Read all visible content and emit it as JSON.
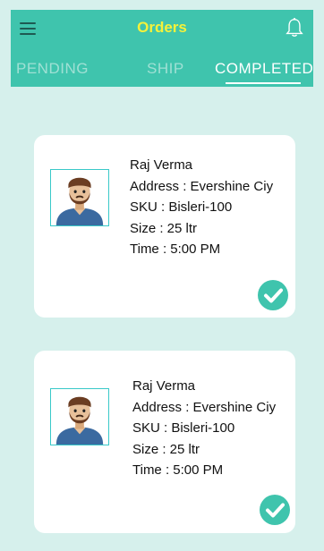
{
  "header": {
    "title": "Orders",
    "menu_icon": "hamburger-menu-icon",
    "bell_icon": "bell-icon",
    "background_color": "#3fc4ad",
    "title_color": "#f5f23a"
  },
  "tabs": [
    {
      "label": "PENDING",
      "active": false
    },
    {
      "label": "SHIP",
      "active": false
    },
    {
      "label": "COMPLETED",
      "active": true
    }
  ],
  "orders": [
    {
      "name": "Raj Verma",
      "address": "Address : Evershine Ciy",
      "sku": "SKU : Bisleri-100",
      "size": "Size : 25 ltr",
      "time": "Time : 5:00 PM",
      "avatar_icon": "bearded-man-avatar-icon",
      "status_icon": "check-circle-icon"
    },
    {
      "name": "Raj Verma",
      "address": "Address : Evershine Ciy",
      "sku": "SKU : Bisleri-100",
      "size": "Size : 25 ltr",
      "time": "Time : 5:00 PM",
      "avatar_icon": "bearded-man-avatar-icon",
      "status_icon": "check-circle-icon"
    }
  ],
  "colors": {
    "page_background": "#d6f0ec",
    "check_color": "#3fc4ad"
  }
}
